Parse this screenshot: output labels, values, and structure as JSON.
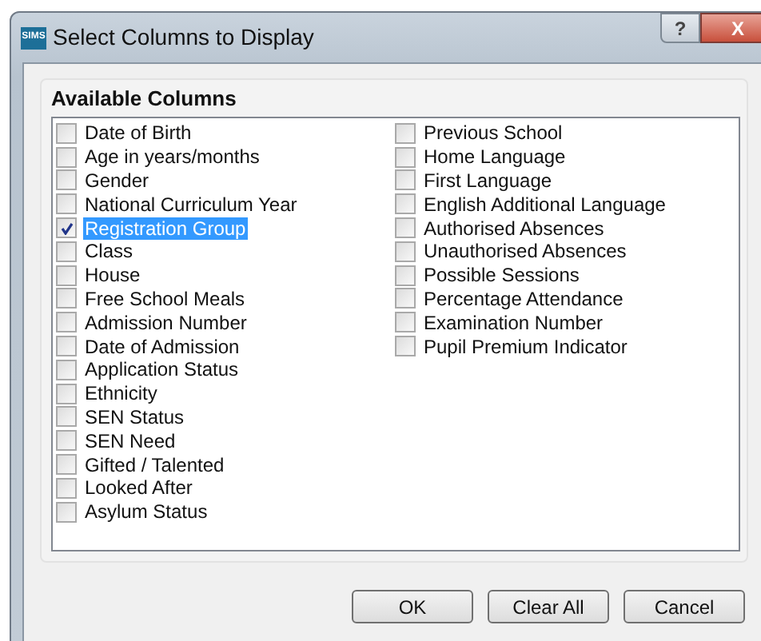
{
  "window": {
    "app_badge": "SIMS",
    "title": "Select Columns to Display",
    "help_button": "?",
    "close_button": "X"
  },
  "group": {
    "title": "Available Columns"
  },
  "columns": [
    [
      {
        "label": "Date of Birth",
        "checked": false,
        "selected": false
      },
      {
        "label": "Age in years/months",
        "checked": false,
        "selected": false
      },
      {
        "label": "Gender",
        "checked": false,
        "selected": false
      },
      {
        "label": "National Curriculum Year",
        "checked": false,
        "selected": false
      },
      {
        "label": "Registration Group",
        "checked": true,
        "selected": true
      },
      {
        "label": "Class",
        "checked": false,
        "selected": false
      },
      {
        "label": "House",
        "checked": false,
        "selected": false
      },
      {
        "label": "Free School Meals",
        "checked": false,
        "selected": false
      },
      {
        "label": "Admission Number",
        "checked": false,
        "selected": false
      },
      {
        "label": "Date of Admission",
        "checked": false,
        "selected": false
      },
      {
        "label": "Application Status",
        "checked": false,
        "selected": false
      },
      {
        "label": "Ethnicity",
        "checked": false,
        "selected": false
      },
      {
        "label": "SEN Status",
        "checked": false,
        "selected": false
      },
      {
        "label": "SEN Need",
        "checked": false,
        "selected": false
      },
      {
        "label": "Gifted / Talented",
        "checked": false,
        "selected": false
      },
      {
        "label": "Looked After",
        "checked": false,
        "selected": false
      },
      {
        "label": "Asylum Status",
        "checked": false,
        "selected": false
      }
    ],
    [
      {
        "label": "Previous School",
        "checked": false,
        "selected": false
      },
      {
        "label": "Home Language",
        "checked": false,
        "selected": false
      },
      {
        "label": "First Language",
        "checked": false,
        "selected": false
      },
      {
        "label": "English Additional Language",
        "checked": false,
        "selected": false
      },
      {
        "label": "Authorised Absences",
        "checked": false,
        "selected": false
      },
      {
        "label": "Unauthorised Absences",
        "checked": false,
        "selected": false
      },
      {
        "label": "Possible Sessions",
        "checked": false,
        "selected": false
      },
      {
        "label": "Percentage Attendance",
        "checked": false,
        "selected": false
      },
      {
        "label": "Examination Number",
        "checked": false,
        "selected": false
      },
      {
        "label": "Pupil Premium Indicator",
        "checked": false,
        "selected": false
      }
    ]
  ],
  "buttons": [
    "OK",
    "Clear All",
    "Cancel"
  ]
}
